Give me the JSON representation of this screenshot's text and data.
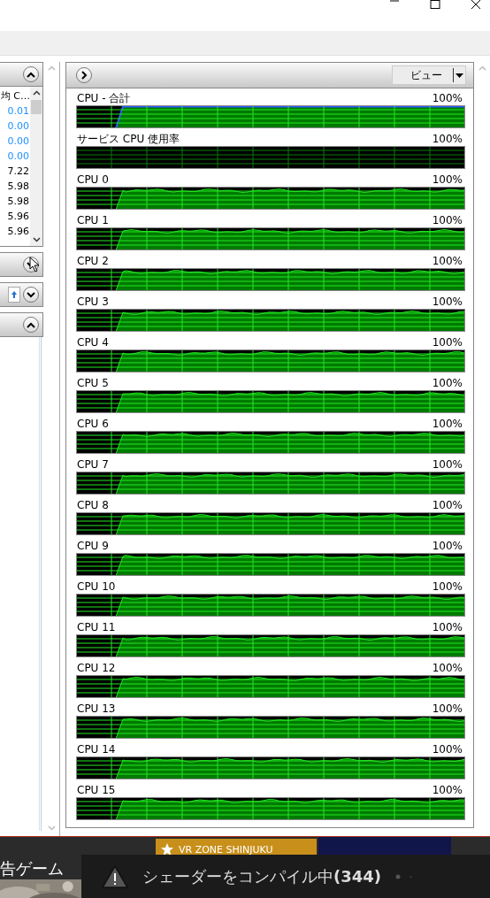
{
  "left_panel": {
    "column_header": "均 C…",
    "values": [
      {
        "text": "0.01",
        "color": "#1e90ff"
      },
      {
        "text": "0.00",
        "color": "#1e90ff"
      },
      {
        "text": "0.00",
        "color": "#1e90ff"
      },
      {
        "text": "0.00",
        "color": "#1e90ff"
      },
      {
        "text": "7.22",
        "color": "#000000"
      },
      {
        "text": "5.98",
        "color": "#000000"
      },
      {
        "text": "5.98",
        "color": "#000000"
      },
      {
        "text": "5.96",
        "color": "#000000"
      },
      {
        "text": "5.96",
        "color": "#000000"
      }
    ]
  },
  "cpu_panel": {
    "view_button": "ビュー",
    "graphs": [
      {
        "label": "CPU - 合計",
        "reading": "100%",
        "kind": "total"
      },
      {
        "label": "サービス CPU 使用率",
        "reading": "100%",
        "kind": "service"
      },
      {
        "label": "CPU 0",
        "reading": "100%",
        "kind": "core"
      },
      {
        "label": "CPU 1",
        "reading": "100%",
        "kind": "core"
      },
      {
        "label": "CPU 2",
        "reading": "100%",
        "kind": "core"
      },
      {
        "label": "CPU 3",
        "reading": "100%",
        "kind": "core"
      },
      {
        "label": "CPU 4",
        "reading": "100%",
        "kind": "core"
      },
      {
        "label": "CPU 5",
        "reading": "100%",
        "kind": "core"
      },
      {
        "label": "CPU 6",
        "reading": "100%",
        "kind": "core"
      },
      {
        "label": "CPU 7",
        "reading": "100%",
        "kind": "core"
      },
      {
        "label": "CPU 8",
        "reading": "100%",
        "kind": "core"
      },
      {
        "label": "CPU 9",
        "reading": "100%",
        "kind": "core"
      },
      {
        "label": "CPU 10",
        "reading": "100%",
        "kind": "core"
      },
      {
        "label": "CPU 11",
        "reading": "100%",
        "kind": "core"
      },
      {
        "label": "CPU 12",
        "reading": "100%",
        "kind": "core"
      },
      {
        "label": "CPU 13",
        "reading": "100%",
        "kind": "core"
      },
      {
        "label": "CPU 14",
        "reading": "100%",
        "kind": "core"
      },
      {
        "label": "CPU 15",
        "reading": "100%",
        "kind": "core"
      }
    ]
  },
  "background": {
    "tile_text": "告ゲーム",
    "banner": "VR ZONE SHINJUKU"
  },
  "toast": {
    "message": "シェーダーをコンパイル中**(344)**"
  }
}
